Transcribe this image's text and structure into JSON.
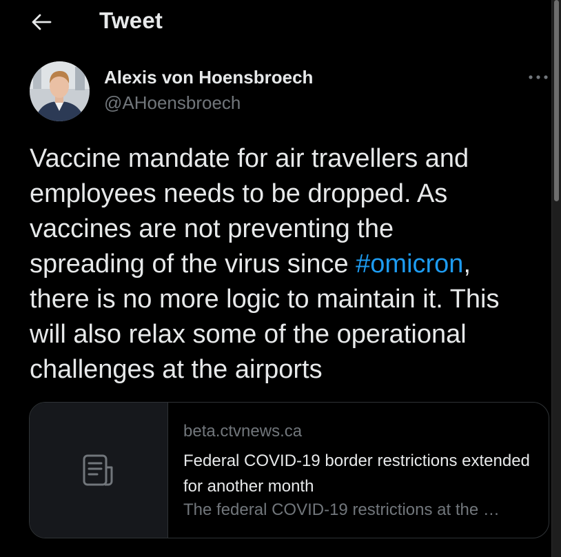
{
  "header": {
    "title": "Tweet",
    "back_icon": "arrow-left-icon"
  },
  "author": {
    "name": "Alexis von Hoensbroech",
    "handle": "@AHoensbroech",
    "avatar_icon": "user-avatar"
  },
  "tweet": {
    "text_before_hashtag": "Vaccine mandate for air travellers and\nemployees needs to be dropped. As\nvaccines are not preventing the\nspreading of the virus since ",
    "hashtag": "#omicron",
    "text_after_hashtag": ",\nthere is no more logic to maintain it. This\nwill also relax some of the operational\nchallenges at the airports"
  },
  "link_card": {
    "domain": "beta.ctvnews.ca",
    "title": "Federal COVID-19 border restrictions extended for another month",
    "description": "The federal COVID-19 restrictions at the …",
    "media_icon": "document-icon"
  },
  "menu": {
    "more_icon": "more-horizontal-icon"
  },
  "colors": {
    "background": "#000000",
    "text_primary": "#e7e9ea",
    "text_secondary": "#71767b",
    "accent": "#1d9bf0",
    "border": "#2f3336"
  }
}
